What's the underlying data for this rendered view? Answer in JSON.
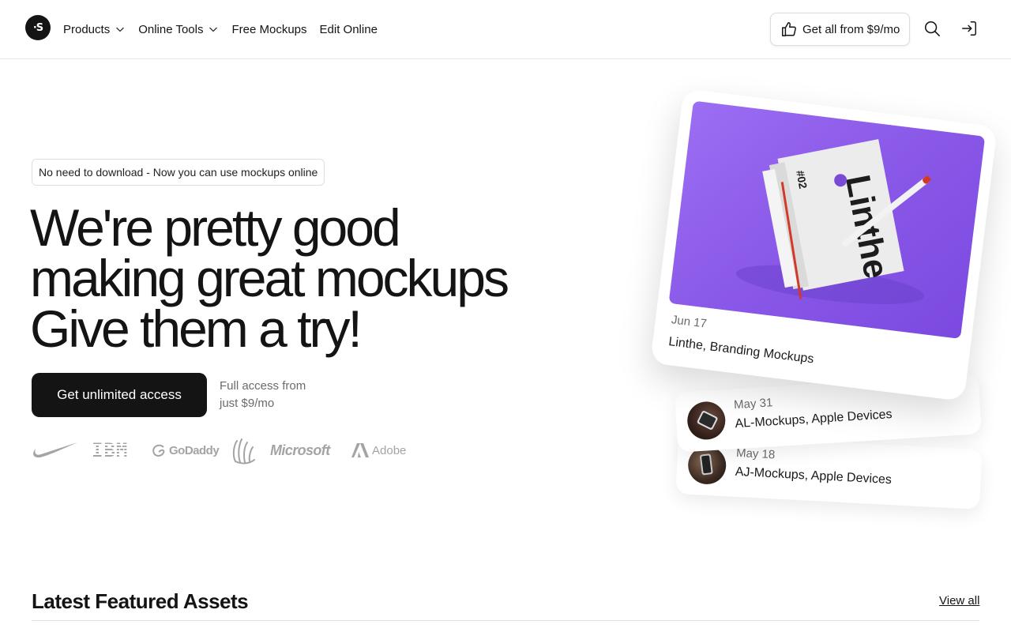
{
  "header": {
    "logo_text": "·S",
    "nav": [
      {
        "label": "Products",
        "has_dropdown": true
      },
      {
        "label": "Online Tools",
        "has_dropdown": true
      },
      {
        "label": "Free Mockups",
        "has_dropdown": false
      },
      {
        "label": "Edit Online",
        "has_dropdown": false
      }
    ],
    "cta_label": "Get all from $9/mo",
    "icons": [
      "thumbs-up-icon",
      "search-icon",
      "sign-in-icon"
    ]
  },
  "hero": {
    "pill": "No need to download - Now you can use mockups online",
    "headline": [
      "We're pretty good",
      "making great mockups",
      "Give them a try!"
    ],
    "primary_button": "Get unlimited access",
    "access_note": [
      "Full access from",
      "just $9/mo"
    ],
    "brands": [
      "Nike",
      "IBM",
      "GoDaddy",
      "Mailchimp",
      "Microsoft",
      "Adobe"
    ]
  },
  "cards": {
    "featured": {
      "date": "Jun 17",
      "title": "Linthe, Branding Mockups",
      "art_text": {
        "brand": "Linthe",
        "issue": "#02"
      },
      "accent_color": "#8b5ae9"
    },
    "items": [
      {
        "date": "May 31",
        "title": "AL-Mockups, Apple Devices"
      },
      {
        "date": "May 18",
        "title": "AJ-Mockups, Apple Devices"
      }
    ]
  },
  "latest": {
    "title": "Latest Featured Assets",
    "view_all": "View all"
  },
  "colors": {
    "text": "#141414",
    "muted": "#6b6b6b",
    "brand_gray": "#a4a4a4",
    "purple": "#8b5ae9"
  }
}
